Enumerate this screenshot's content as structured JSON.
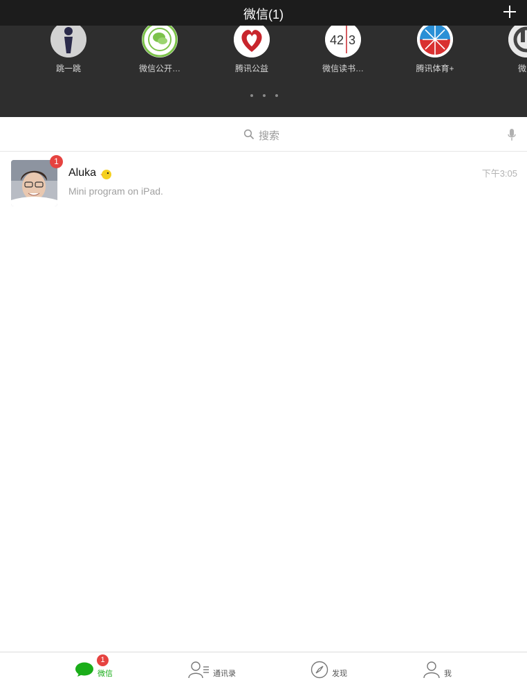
{
  "nav": {
    "title": "微信(1)"
  },
  "mini_programs": [
    {
      "label": "跳一跳",
      "icon": "tiaoyitiao-icon"
    },
    {
      "label": "微信公开…",
      "icon": "wechat-open-class-icon"
    },
    {
      "label": "腾讯公益",
      "icon": "tencent-charity-icon"
    },
    {
      "label": "微信读书…",
      "icon": "wechat-reading-icon",
      "icon_text_left": "42",
      "icon_text_right": "3"
    },
    {
      "label": "腾讯体育+",
      "icon": "tencent-sports-icon"
    },
    {
      "label": "微众",
      "icon": "weizhong-icon"
    }
  ],
  "search": {
    "placeholder": "搜索"
  },
  "chats": [
    {
      "name": "Aluka",
      "preview": "Mini program on iPad.",
      "time": "下午3:05",
      "unread": "1"
    }
  ],
  "tabs": [
    {
      "label": "微信",
      "active": true,
      "badge": "1"
    },
    {
      "label": "通讯录",
      "active": false
    },
    {
      "label": "发现",
      "active": false
    },
    {
      "label": "我",
      "active": false
    }
  ],
  "colors": {
    "accent_green": "#1aad19",
    "badge_red": "#e64340",
    "dark_bg": "#2e2e2e",
    "nav_bg": "#1c1c1c"
  }
}
